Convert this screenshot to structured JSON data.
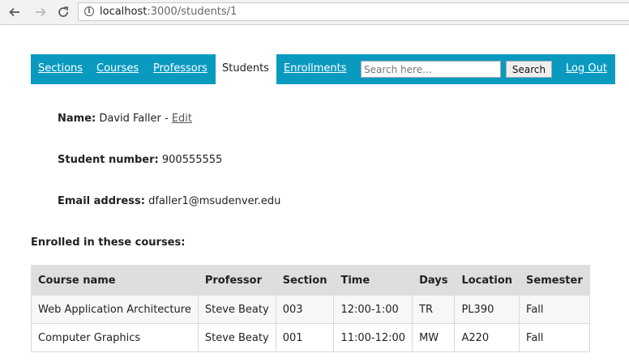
{
  "browser": {
    "url_host": "localhost",
    "url_path": ":3000/students/1"
  },
  "nav": {
    "sections": "Sections",
    "courses": "Courses",
    "professors": "Professors",
    "students": "Students",
    "enrollments": "Enrollments",
    "search_placeholder": "Search here...",
    "search_button": "Search",
    "logout": "Log Out"
  },
  "student": {
    "name_label": "Name:",
    "name": "David Faller",
    "name_sep": " - ",
    "edit_label": "Edit",
    "number_label": "Student number:",
    "number": "900555555",
    "email_label": "Email address:",
    "email": "dfaller1@msudenver.edu"
  },
  "enrolled_heading": "Enrolled in these courses:",
  "table": {
    "headers": [
      "Course name",
      "Professor",
      "Section",
      "Time",
      "Days",
      "Location",
      "Semester"
    ],
    "rows": [
      [
        "Web Application Architecture",
        "Steve Beaty",
        "003",
        "12:00-1:00",
        "TR",
        "PL390",
        "Fall"
      ],
      [
        "Computer Graphics",
        "Steve Beaty",
        "001",
        "11:00-12:00",
        "MW",
        "A220",
        "Fall"
      ]
    ]
  }
}
